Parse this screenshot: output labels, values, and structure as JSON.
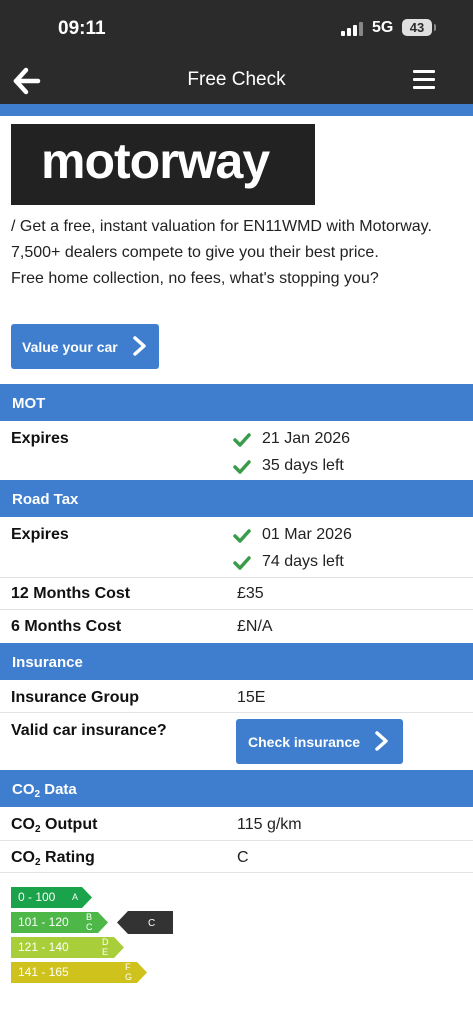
{
  "status_bar": {
    "time": "09:11",
    "network": "5G",
    "battery": "43"
  },
  "nav": {
    "title": "Free Check"
  },
  "promo": {
    "logo_text": "motorway",
    "text_line1": "/ Get a free, instant valuation for EN11WMD with Motorway. 7,500+ dealers compete to give you their best price.",
    "text_line2": "Free home collection, no fees, what's stopping you?",
    "button_label": "Value your car"
  },
  "mot": {
    "header": "MOT",
    "expires_label": "Expires",
    "expiry_date": "21 Jan 2026",
    "days_left": "35 days left"
  },
  "road_tax": {
    "header": "Road Tax",
    "expires_label": "Expires",
    "expiry_date": "01 Mar 2026",
    "days_left": "74 days left",
    "twelve_months_label": "12 Months Cost",
    "twelve_months_value": "£35",
    "six_months_label": "6 Months Cost",
    "six_months_value": "£N/A"
  },
  "insurance": {
    "header": "Insurance",
    "group_label": "Insurance Group",
    "group_value": "15E",
    "valid_label": "Valid car insurance?",
    "button_label": "Check insurance"
  },
  "co2": {
    "header_prefix": "CO",
    "header_suffix": " Data",
    "output_label_suffix": " Output",
    "output_value": "115 g/km",
    "rating_label_suffix": " Rating",
    "rating_value": "C",
    "bands": [
      {
        "range": "0 - 100",
        "letter_top": "A",
        "letter_bottom": "",
        "color": "#1aa34a"
      },
      {
        "range": "101 - 120",
        "letter_top": "B",
        "letter_bottom": "C",
        "color": "#4db848"
      },
      {
        "range": "121 - 140",
        "letter_top": "D",
        "letter_bottom": "E",
        "color": "#a8cf3a"
      },
      {
        "range": "141 - 165",
        "letter_top": "F",
        "letter_bottom": "G",
        "color": "#cfc21c"
      }
    ],
    "marker_letter": "C",
    "marker_color": "#333333"
  },
  "colors": {
    "accent_blue": "#3f7ecf",
    "check_green": "#3a9c4a",
    "bar_dark": "#2b2b2b"
  }
}
